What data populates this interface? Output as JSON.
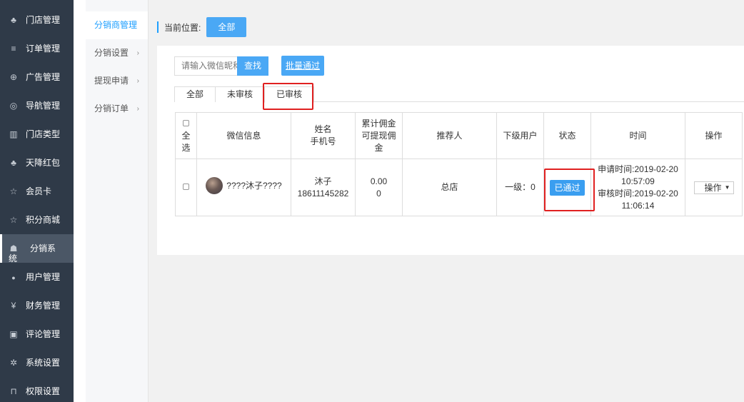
{
  "nav": {
    "items": [
      {
        "icon": "cubes-icon",
        "glyph": "♣",
        "label": "门店管理"
      },
      {
        "icon": "list-icon",
        "glyph": "≡",
        "label": "订单管理"
      },
      {
        "icon": "lifebuoy-icon",
        "glyph": "⊕",
        "label": "广告管理"
      },
      {
        "icon": "compass-icon",
        "glyph": "◎",
        "label": "导航管理"
      },
      {
        "icon": "bank-icon",
        "glyph": "▥",
        "label": "门店类型"
      },
      {
        "icon": "cubes-icon",
        "glyph": "♣",
        "label": "天降红包"
      },
      {
        "icon": "star-icon",
        "glyph": "☆",
        "label": "会员卡"
      },
      {
        "icon": "star-icon",
        "glyph": "☆",
        "label": "积分商城"
      },
      {
        "icon": "users-icon",
        "glyph": "☗",
        "label_line1": "分销系",
        "label_line2": "统"
      },
      {
        "icon": "user-icon",
        "glyph": "●",
        "label": "用户管理"
      },
      {
        "icon": "yen-icon",
        "glyph": "¥",
        "label": "财务管理"
      },
      {
        "icon": "money-icon",
        "glyph": "▣",
        "label": "评论管理"
      },
      {
        "icon": "gear-icon",
        "glyph": "✲",
        "label": "系统设置"
      },
      {
        "icon": "lock-icon",
        "glyph": "⊓",
        "label": "权限设置"
      }
    ]
  },
  "submenu": {
    "items": [
      {
        "label": "分销商管理",
        "arrow": ""
      },
      {
        "label": "分销设置",
        "arrow": "›"
      },
      {
        "label": "提现申请",
        "arrow": "›"
      },
      {
        "label": "分销订单",
        "arrow": "›"
      }
    ]
  },
  "breadcrumb": {
    "label": "当前位置:",
    "button": "全部"
  },
  "search": {
    "placeholder": "请输入微信昵称",
    "find_button": "查找",
    "batch_button": "批量通过"
  },
  "tabs": [
    "全部",
    "未审核",
    "已审核"
  ],
  "table": {
    "headers": {
      "select_all_line1": "全",
      "select_all_line2": "选",
      "wechat": "微信信息",
      "name_line1": "姓名",
      "name_line2": "手机号",
      "commission_line1": "累计佣金",
      "commission_line2": "可提现佣",
      "commission_line3": "金",
      "referrer": "推荐人",
      "subordinates": "下级用户",
      "status": "状态",
      "time": "时间",
      "action": "操作"
    },
    "rows": [
      {
        "nickname": "????沐子????",
        "name": "沐子",
        "phone": "18611145282",
        "total_commission": "0.00",
        "withdrawable": "0",
        "referrer": "总店",
        "subordinates": "一级：0",
        "status": "已通过",
        "apply_time_line1": "申请时间:2019-02-20",
        "apply_time_line2": "10:57:09",
        "review_time_line1": "审核时间:2019-02-20",
        "review_time_line2": "11:06:14",
        "action": "操作"
      }
    ]
  },
  "colors": {
    "nav_bg": "#2f3a48",
    "accent": "#4aa8f5",
    "highlight_box": "#e02020"
  }
}
